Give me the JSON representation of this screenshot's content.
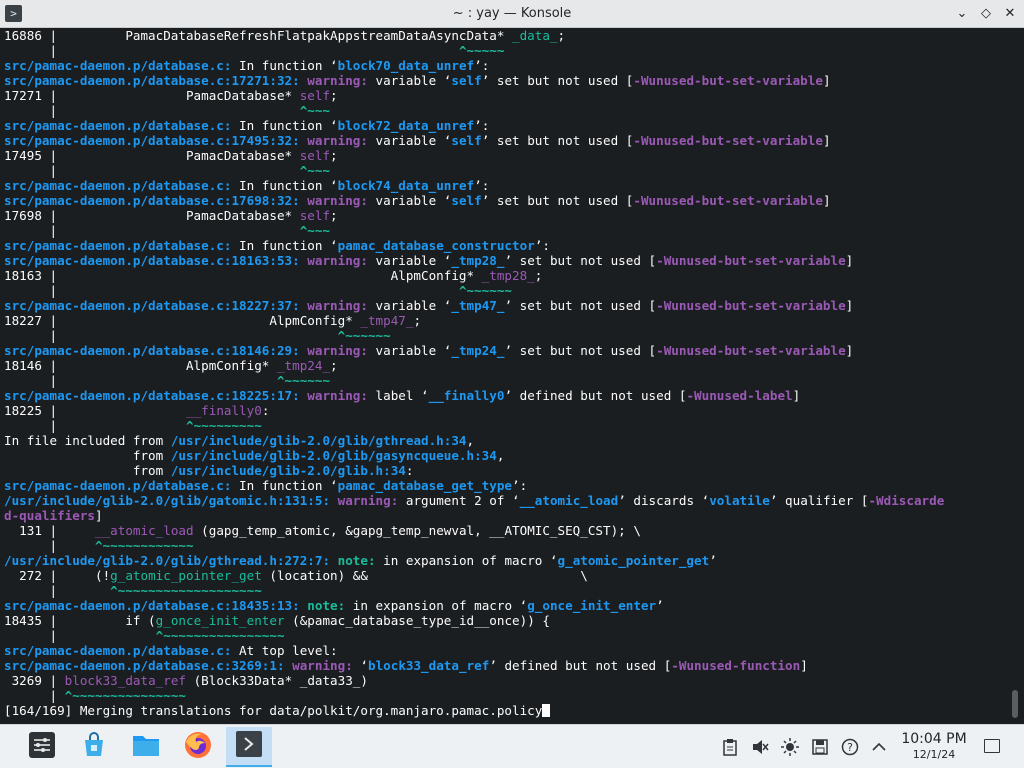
{
  "window": {
    "title": "~ : yay — Konsole",
    "app_icon_glyph": ">",
    "buttons": {
      "minimize": "⌄",
      "maximize": "◇",
      "close": "✕"
    }
  },
  "terminal": {
    "lines": [
      [
        {
          "t": "16886 |         PamacDatabaseRefreshFlatpakAppstreamDataAsyncData* "
        },
        {
          "t": "_data_",
          "c": "c-hl-green"
        },
        {
          "t": ";"
        }
      ],
      [
        {
          "t": "      |                                                     "
        },
        {
          "t": "^~~~~~",
          "c": "c-caret"
        }
      ],
      [
        {
          "t": "src/pamac-daemon.p/database.c:",
          "c": "c-blue"
        },
        {
          "t": " In function ‘"
        },
        {
          "t": "block70_data_unref",
          "c": "c-blue"
        },
        {
          "t": "’:"
        }
      ],
      [
        {
          "t": "src/pamac-daemon.p/database.c:17271:32:",
          "c": "c-blue"
        },
        {
          "t": " "
        },
        {
          "t": "warning:",
          "c": "c-warn"
        },
        {
          "t": " variable ‘"
        },
        {
          "t": "self",
          "c": "c-blue"
        },
        {
          "t": "’ set but not used ["
        },
        {
          "t": "-Wunused-but-set-variable",
          "c": "c-flag"
        },
        {
          "t": "]"
        }
      ],
      [
        {
          "t": "17271 |                 PamacDatabase* "
        },
        {
          "t": "self",
          "c": "c-hl-purple"
        },
        {
          "t": ";"
        }
      ],
      [
        {
          "t": "      |                                "
        },
        {
          "t": "^~~~",
          "c": "c-caret"
        }
      ],
      [
        {
          "t": "src/pamac-daemon.p/database.c:",
          "c": "c-blue"
        },
        {
          "t": " In function ‘"
        },
        {
          "t": "block72_data_unref",
          "c": "c-blue"
        },
        {
          "t": "’:"
        }
      ],
      [
        {
          "t": "src/pamac-daemon.p/database.c:17495:32:",
          "c": "c-blue"
        },
        {
          "t": " "
        },
        {
          "t": "warning:",
          "c": "c-warn"
        },
        {
          "t": " variable ‘"
        },
        {
          "t": "self",
          "c": "c-blue"
        },
        {
          "t": "’ set but not used ["
        },
        {
          "t": "-Wunused-but-set-variable",
          "c": "c-flag"
        },
        {
          "t": "]"
        }
      ],
      [
        {
          "t": "17495 |                 PamacDatabase* "
        },
        {
          "t": "self",
          "c": "c-hl-purple"
        },
        {
          "t": ";"
        }
      ],
      [
        {
          "t": "      |                                "
        },
        {
          "t": "^~~~",
          "c": "c-caret"
        }
      ],
      [
        {
          "t": "src/pamac-daemon.p/database.c:",
          "c": "c-blue"
        },
        {
          "t": " In function ‘"
        },
        {
          "t": "block74_data_unref",
          "c": "c-blue"
        },
        {
          "t": "’:"
        }
      ],
      [
        {
          "t": "src/pamac-daemon.p/database.c:17698:32:",
          "c": "c-blue"
        },
        {
          "t": " "
        },
        {
          "t": "warning:",
          "c": "c-warn"
        },
        {
          "t": " variable ‘"
        },
        {
          "t": "self",
          "c": "c-blue"
        },
        {
          "t": "’ set but not used ["
        },
        {
          "t": "-Wunused-but-set-variable",
          "c": "c-flag"
        },
        {
          "t": "]"
        }
      ],
      [
        {
          "t": "17698 |                 PamacDatabase* "
        },
        {
          "t": "self",
          "c": "c-hl-purple"
        },
        {
          "t": ";"
        }
      ],
      [
        {
          "t": "      |                                "
        },
        {
          "t": "^~~~",
          "c": "c-caret"
        }
      ],
      [
        {
          "t": "src/pamac-daemon.p/database.c:",
          "c": "c-blue"
        },
        {
          "t": " In function ‘"
        },
        {
          "t": "pamac_database_constructor",
          "c": "c-blue"
        },
        {
          "t": "’:"
        }
      ],
      [
        {
          "t": "src/pamac-daemon.p/database.c:18163:53:",
          "c": "c-blue"
        },
        {
          "t": " "
        },
        {
          "t": "warning:",
          "c": "c-warn"
        },
        {
          "t": " variable ‘"
        },
        {
          "t": "_tmp28_",
          "c": "c-blue"
        },
        {
          "t": "’ set but not used ["
        },
        {
          "t": "-Wunused-but-set-variable",
          "c": "c-flag"
        },
        {
          "t": "]"
        }
      ],
      [
        {
          "t": "18163 |                                            AlpmConfig* "
        },
        {
          "t": "_tmp28_",
          "c": "c-hl-purple"
        },
        {
          "t": ";"
        }
      ],
      [
        {
          "t": "      |                                                     "
        },
        {
          "t": "^~~~~~~",
          "c": "c-caret"
        }
      ],
      [
        {
          "t": "src/pamac-daemon.p/database.c:18227:37:",
          "c": "c-blue"
        },
        {
          "t": " "
        },
        {
          "t": "warning:",
          "c": "c-warn"
        },
        {
          "t": " variable ‘"
        },
        {
          "t": "_tmp47_",
          "c": "c-blue"
        },
        {
          "t": "’ set but not used ["
        },
        {
          "t": "-Wunused-but-set-variable",
          "c": "c-flag"
        },
        {
          "t": "]"
        }
      ],
      [
        {
          "t": "18227 |                            AlpmConfig* "
        },
        {
          "t": "_tmp47_",
          "c": "c-hl-purple"
        },
        {
          "t": ";"
        }
      ],
      [
        {
          "t": "      |                                     "
        },
        {
          "t": "^~~~~~~",
          "c": "c-caret"
        }
      ],
      [
        {
          "t": "src/pamac-daemon.p/database.c:18146:29:",
          "c": "c-blue"
        },
        {
          "t": " "
        },
        {
          "t": "warning:",
          "c": "c-warn"
        },
        {
          "t": " variable ‘"
        },
        {
          "t": "_tmp24_",
          "c": "c-blue"
        },
        {
          "t": "’ set but not used ["
        },
        {
          "t": "-Wunused-but-set-variable",
          "c": "c-flag"
        },
        {
          "t": "]"
        }
      ],
      [
        {
          "t": "18146 |                 AlpmConfig* "
        },
        {
          "t": "_tmp24_",
          "c": "c-hl-purple"
        },
        {
          "t": ";"
        }
      ],
      [
        {
          "t": "      |                             "
        },
        {
          "t": "^~~~~~~",
          "c": "c-caret"
        }
      ],
      [
        {
          "t": "src/pamac-daemon.p/database.c:18225:17:",
          "c": "c-blue"
        },
        {
          "t": " "
        },
        {
          "t": "warning:",
          "c": "c-warn"
        },
        {
          "t": " label ‘"
        },
        {
          "t": "__finally0",
          "c": "c-blue"
        },
        {
          "t": "’ defined but not used ["
        },
        {
          "t": "-Wunused-label",
          "c": "c-flag"
        },
        {
          "t": "]"
        }
      ],
      [
        {
          "t": "18225 |                 "
        },
        {
          "t": "__finally0",
          "c": "c-hl-purple"
        },
        {
          "t": ":"
        }
      ],
      [
        {
          "t": "      |                 "
        },
        {
          "t": "^~~~~~~~~~",
          "c": "c-caret"
        }
      ],
      [
        {
          "t": "In file included from "
        },
        {
          "t": "/usr/include/glib-2.0/glib/gthread.h:34",
          "c": "c-blue"
        },
        {
          "t": ","
        }
      ],
      [
        {
          "t": "                 from "
        },
        {
          "t": "/usr/include/glib-2.0/glib/gasyncqueue.h:34",
          "c": "c-blue"
        },
        {
          "t": ","
        }
      ],
      [
        {
          "t": "                 from "
        },
        {
          "t": "/usr/include/glib-2.0/glib.h:34",
          "c": "c-blue"
        },
        {
          "t": ":"
        }
      ],
      [
        {
          "t": "src/pamac-daemon.p/database.c:",
          "c": "c-blue"
        },
        {
          "t": " In function ‘"
        },
        {
          "t": "pamac_database_get_type",
          "c": "c-blue"
        },
        {
          "t": "’:"
        }
      ],
      [
        {
          "t": "/usr/include/glib-2.0/glib/gatomic.h:131:5:",
          "c": "c-blue"
        },
        {
          "t": " "
        },
        {
          "t": "warning:",
          "c": "c-warn"
        },
        {
          "t": " argument 2 of ‘"
        },
        {
          "t": "__atomic_load",
          "c": "c-blue"
        },
        {
          "t": "’ discards ‘"
        },
        {
          "t": "volatile",
          "c": "c-blue"
        },
        {
          "t": "’ qualifier ["
        },
        {
          "t": "-Wdiscarde",
          "c": "c-flag"
        }
      ],
      [
        {
          "t": "d-qualifiers",
          "c": "c-flag"
        },
        {
          "t": "]"
        }
      ],
      [
        {
          "t": "  131 |     "
        },
        {
          "t": "__atomic_load",
          "c": "c-hl-purple"
        },
        {
          "t": " (gapg_temp_atomic, &gapg_temp_newval, __ATOMIC_SEQ_CST); \\"
        }
      ],
      [
        {
          "t": "      |     "
        },
        {
          "t": "^~~~~~~~~~~~~",
          "c": "c-caret"
        }
      ],
      [
        {
          "t": "/usr/include/glib-2.0/glib/gthread.h:272:7:",
          "c": "c-blue"
        },
        {
          "t": " "
        },
        {
          "t": "note:",
          "c": "c-note"
        },
        {
          "t": " in expansion of macro ‘"
        },
        {
          "t": "g_atomic_pointer_get",
          "c": "c-blue"
        },
        {
          "t": "’"
        }
      ],
      [
        {
          "t": "  272 |     (!"
        },
        {
          "t": "g_atomic_pointer_get",
          "c": "c-hl-green"
        },
        {
          "t": " (location) &&                            \\"
        }
      ],
      [
        {
          "t": "      |       "
        },
        {
          "t": "^~~~~~~~~~~~~~~~~~~~",
          "c": "c-caret"
        }
      ],
      [
        {
          "t": "src/pamac-daemon.p/database.c:18435:13:",
          "c": "c-blue"
        },
        {
          "t": " "
        },
        {
          "t": "note:",
          "c": "c-note"
        },
        {
          "t": " in expansion of macro ‘"
        },
        {
          "t": "g_once_init_enter",
          "c": "c-blue"
        },
        {
          "t": "’"
        }
      ],
      [
        {
          "t": "18435 |         if ("
        },
        {
          "t": "g_once_init_enter",
          "c": "c-hl-green"
        },
        {
          "t": " (&pamac_database_type_id__once)) {"
        }
      ],
      [
        {
          "t": "      |             "
        },
        {
          "t": "^~~~~~~~~~~~~~~~~",
          "c": "c-caret"
        }
      ],
      [
        {
          "t": "src/pamac-daemon.p/database.c:",
          "c": "c-blue"
        },
        {
          "t": " At top level:"
        }
      ],
      [
        {
          "t": "src/pamac-daemon.p/database.c:3269:1:",
          "c": "c-blue"
        },
        {
          "t": " "
        },
        {
          "t": "warning:",
          "c": "c-warn"
        },
        {
          "t": " ‘"
        },
        {
          "t": "block33_data_ref",
          "c": "c-blue"
        },
        {
          "t": "’ defined but not used ["
        },
        {
          "t": "-Wunused-function",
          "c": "c-flag"
        },
        {
          "t": "]"
        }
      ],
      [
        {
          "t": " 3269 | "
        },
        {
          "t": "block33_data_ref",
          "c": "c-hl-purple"
        },
        {
          "t": " (Block33Data* _data33_)"
        }
      ],
      [
        {
          "t": "      | "
        },
        {
          "t": "^~~~~~~~~~~~~~~~",
          "c": "c-caret"
        }
      ],
      [
        {
          "t": "[164/169] Merging translations for data/polkit/org.manjaro.pamac.policy"
        }
      ]
    ]
  },
  "taskbar": {
    "launchers": [
      {
        "name": "application-launcher-icon"
      },
      {
        "name": "discover-store-icon"
      },
      {
        "name": "file-manager-icon"
      },
      {
        "name": "firefox-icon"
      },
      {
        "name": "konsole-icon"
      }
    ],
    "tray": {
      "time": "10:04 PM",
      "date": "12/1/24"
    },
    "colors": {
      "accent": "#3daee9",
      "terminal_bg": "#1b1e20"
    }
  }
}
